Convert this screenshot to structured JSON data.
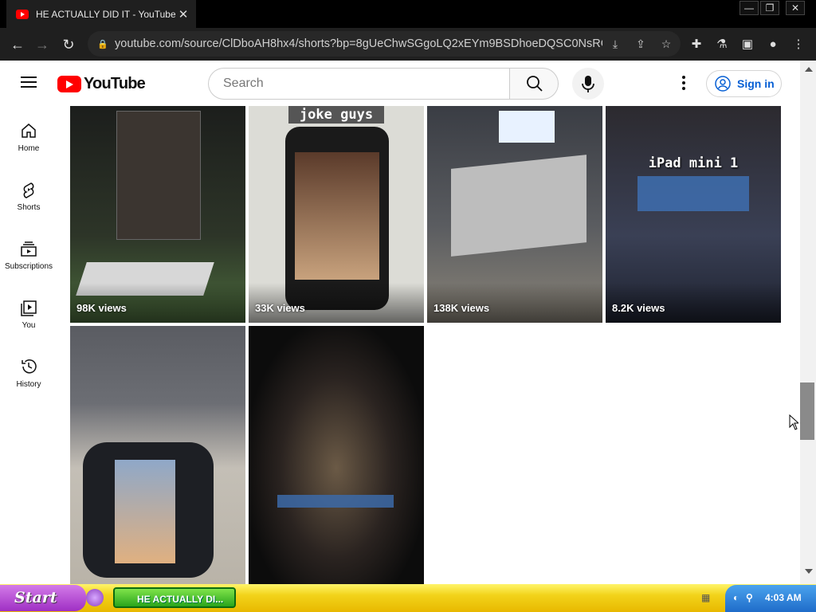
{
  "browser": {
    "tab_title": "HE ACTUALLY DID IT  - YouTube",
    "url": "youtube.com/source/ClDboAH8hx4/shorts?bp=8gUeChwSGgoLQ2xEYm9BSDhoeDQSC0NsRGJv...",
    "window_buttons": [
      "—",
      "❐",
      "✕"
    ]
  },
  "youtube": {
    "logo_text": "YouTube",
    "search_placeholder": "Search",
    "signin_label": "Sign in",
    "sidebar": [
      {
        "label": "Home",
        "icon": "home-icon"
      },
      {
        "label": "Shorts",
        "icon": "shorts-icon"
      },
      {
        "label": "Subscriptions",
        "icon": "subscriptions-icon"
      },
      {
        "label": "You",
        "icon": "you-icon"
      },
      {
        "label": "History",
        "icon": "history-icon"
      }
    ],
    "shorts": [
      {
        "views": "98K views",
        "overlay": "",
        "bg": "#2a2e25"
      },
      {
        "views": "33K views",
        "overlay": "joke guys",
        "bg": "#d8d8d3"
      },
      {
        "views": "138K views",
        "overlay": "",
        "bg": "#3e4046"
      },
      {
        "views": "8.2K views",
        "overlay": "iPad mini 1",
        "bg": "#23293a"
      },
      {
        "views": "",
        "overlay": "",
        "bg": "#4a4d55"
      },
      {
        "views": "",
        "overlay": "",
        "bg": "#111111"
      }
    ]
  },
  "taskbar": {
    "start_label": "Start",
    "task_label": "HE ACTUALLY DI...",
    "clock": "4:03 AM"
  }
}
